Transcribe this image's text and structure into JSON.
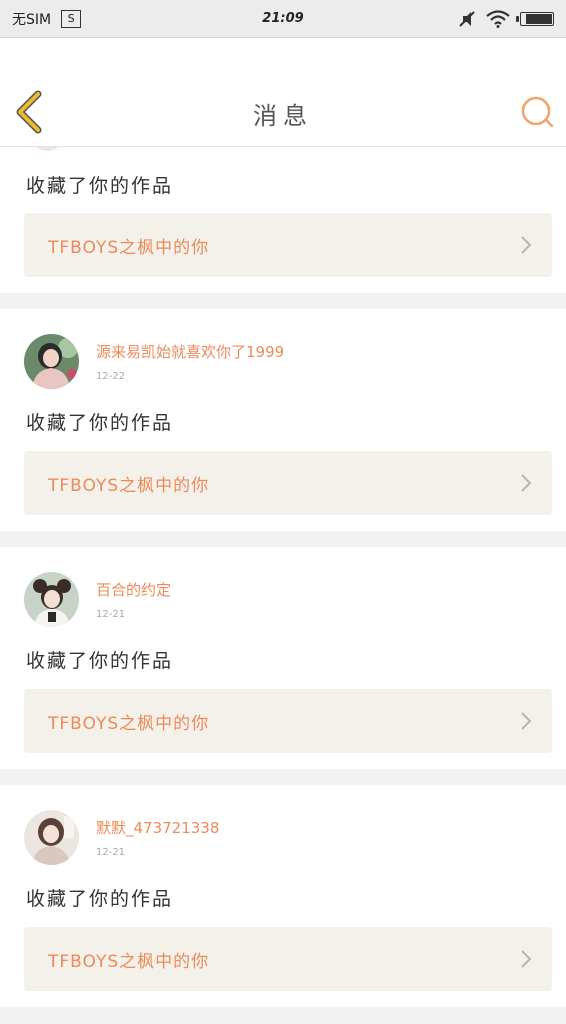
{
  "status_bar": {
    "carrier": "无SIM",
    "sim_icon_label": "S",
    "time": "21:09",
    "battery_level": 0.9,
    "icons": [
      "sim-icon",
      "mute-icon",
      "wifi-icon",
      "battery-icon"
    ]
  },
  "header": {
    "title": "消息",
    "back_icon": "chevron-left-icon",
    "search_icon": "search-icon",
    "accent_color": "#f0a46e",
    "back_color": "#e3b41a"
  },
  "messages": [
    {
      "username": "",
      "date": "",
      "action": "收藏了你的作品",
      "work_title": "TFBOYS之枫中的你"
    },
    {
      "username": "源来易凯始就喜欢你了1999",
      "date": "12-22",
      "action": "收藏了你的作品",
      "work_title": "TFBOYS之枫中的你"
    },
    {
      "username": "百合的约定",
      "date": "12-21",
      "action": "收藏了你的作品",
      "work_title": "TFBOYS之枫中的你"
    },
    {
      "username": "默默_473721338",
      "date": "12-21",
      "action": "收藏了你的作品",
      "work_title": "TFBOYS之枫中的你"
    }
  ]
}
